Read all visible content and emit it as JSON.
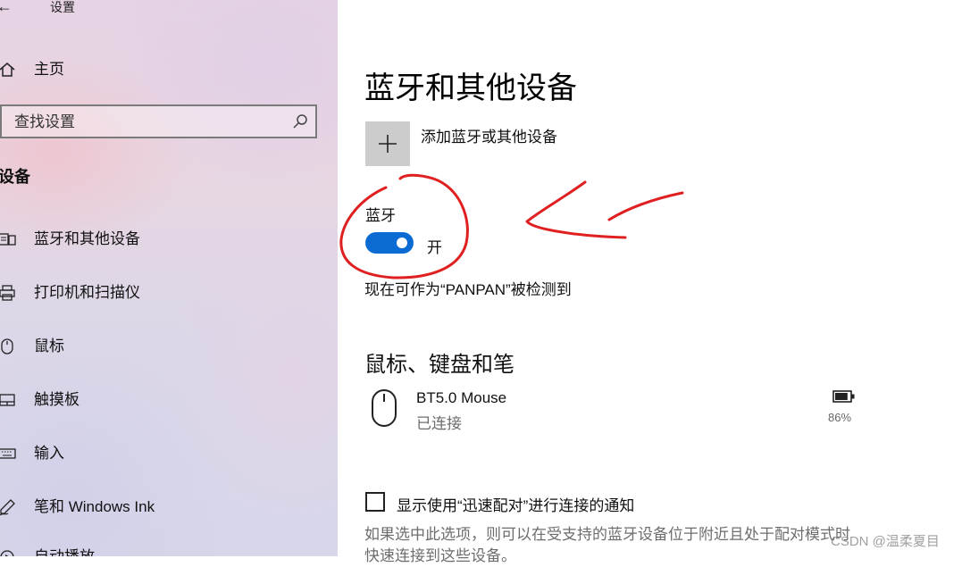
{
  "window": {
    "title": "设置"
  },
  "sidebar": {
    "home_label": "主页",
    "search": {
      "placeholder": "查找设置"
    },
    "section_heading": "设备",
    "items": [
      {
        "label": "蓝牙和其他设备",
        "icon": "bluetooth-keyboard-icon"
      },
      {
        "label": "打印机和扫描仪",
        "icon": "printer-icon"
      },
      {
        "label": "鼠标",
        "icon": "mouse-icon"
      },
      {
        "label": "触摸板",
        "icon": "touchpad-icon"
      },
      {
        "label": "输入",
        "icon": "keyboard-icon"
      },
      {
        "label": "笔和 Windows Ink",
        "icon": "pen-icon"
      },
      {
        "label": "自动播放",
        "icon": "autoplay-icon"
      }
    ]
  },
  "main": {
    "title": "蓝牙和其他设备",
    "add_device_label": "添加蓝牙或其他设备",
    "bluetooth": {
      "label": "蓝牙",
      "state_label": "开",
      "is_on": true,
      "discoverable_text": "现在可作为“PANPAN”被检测到"
    },
    "mouse_keyboard_pen": {
      "heading": "鼠标、键盘和笔",
      "devices": [
        {
          "name": "BT5.0 Mouse",
          "status": "已连接",
          "battery": "86%",
          "battery_fraction": 0.86
        }
      ]
    },
    "swift_pair": {
      "label": "显示使用“迅速配对”进行连接的通知",
      "checked": false,
      "description": "如果选中此选项，则可以在受支持的蓝牙设备位于附近且处于配对模式时快速连接到这些设备。"
    }
  },
  "watermark": "CSDN @温柔夏目",
  "colors": {
    "accent": "#0a6cd3",
    "annotation": "#e02020",
    "add_button_bg": "#cccccc"
  }
}
